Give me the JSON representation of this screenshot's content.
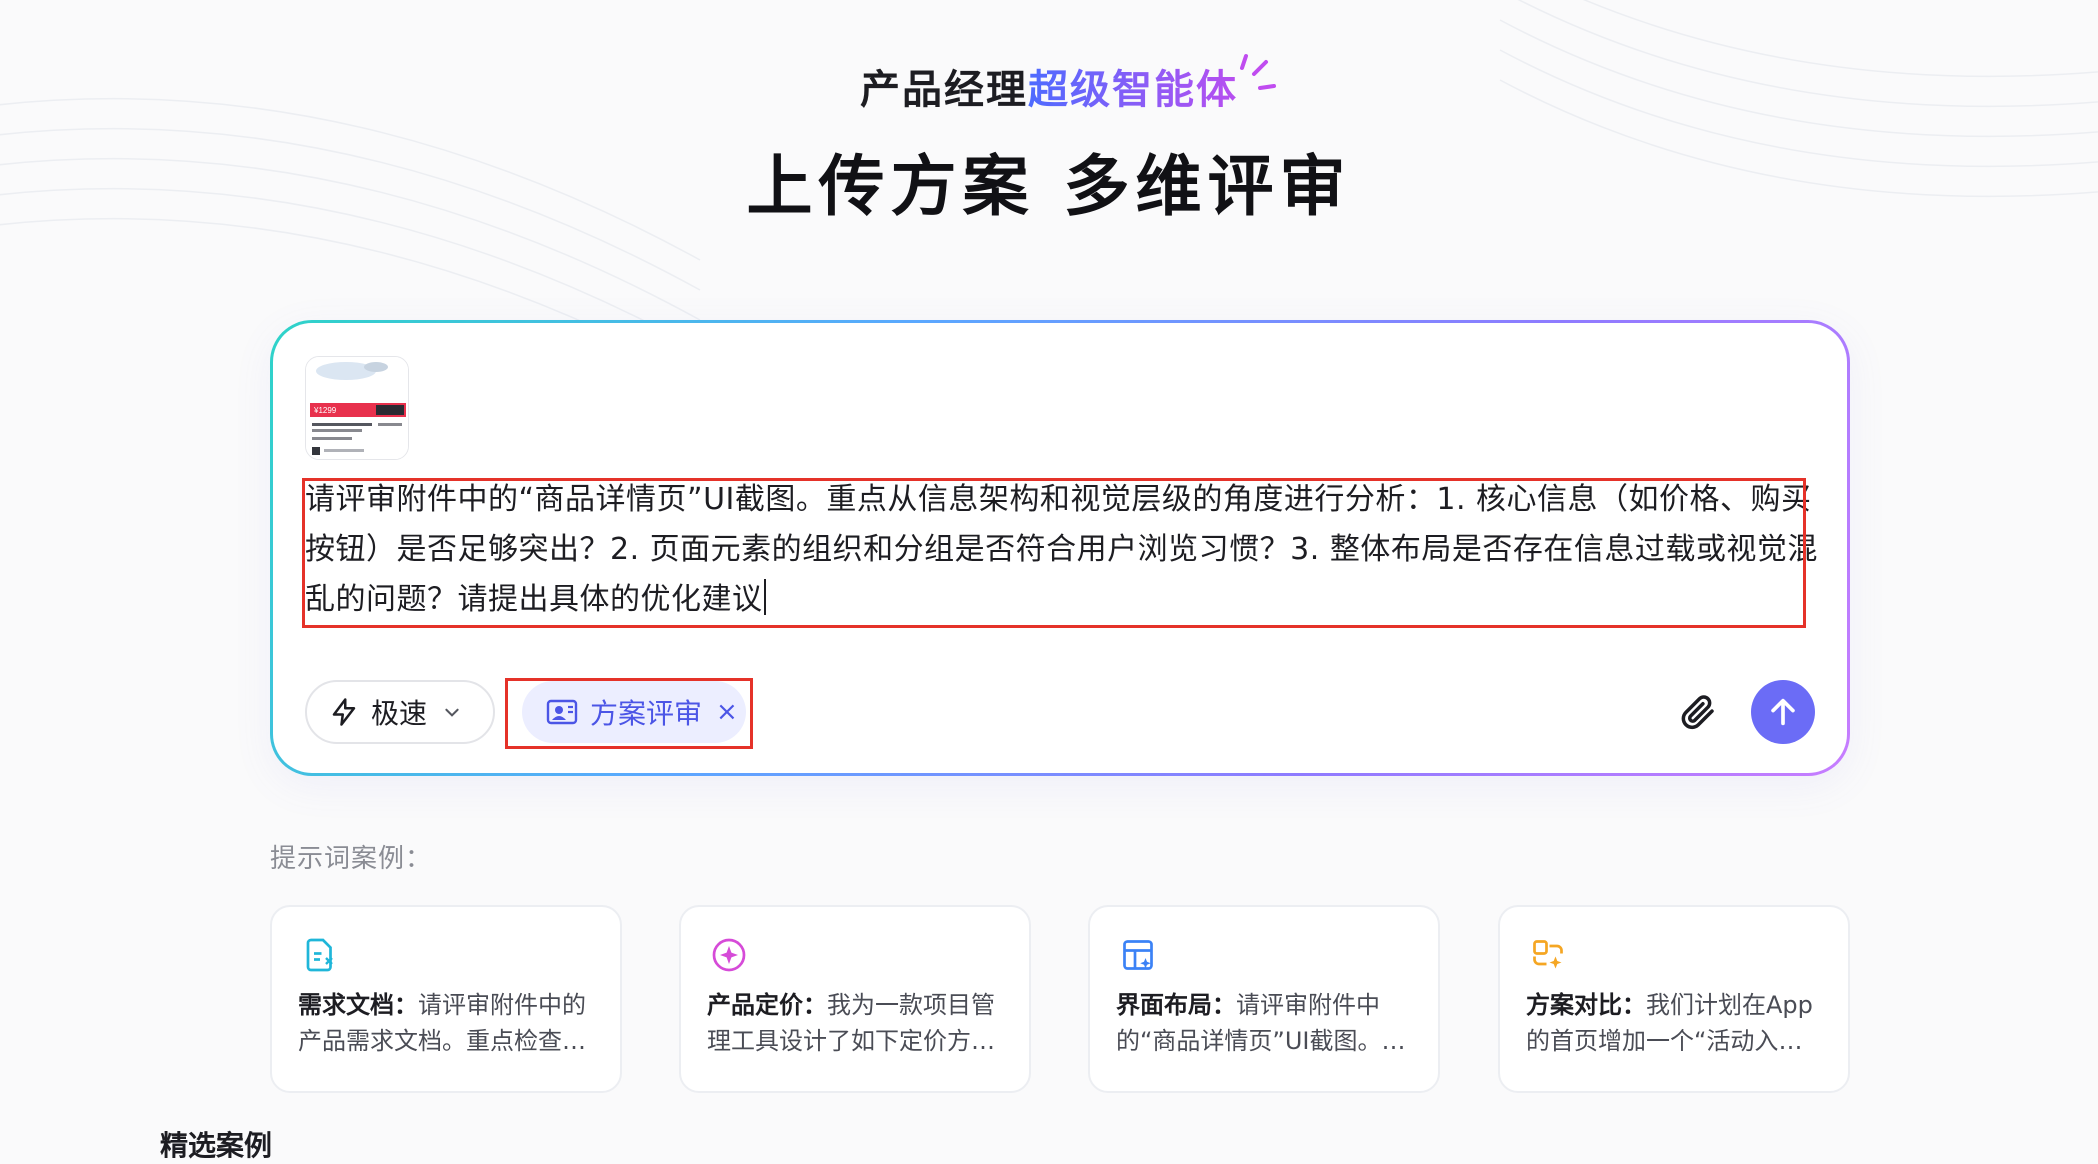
{
  "hero": {
    "subtitle_prefix": "产品经理",
    "subtitle_highlight": "超级智能体",
    "title": "上传方案 多维评审"
  },
  "composer": {
    "prompt_text": "请评审附件中的“商品详情页”UI截图。重点从信息架构和视觉层级的角度进行分析：1. 核心信息（如价格、购买按钮）是否足够突出？2. 页面元素的组织和分组是否符合用户浏览习惯？3. 整体布局是否存在信息过载或视觉混乱的问题？请提出具体的优化建议",
    "mode_label": "极速",
    "tag_label": "方案评审",
    "tag_close": "×",
    "attachment": {
      "thumb_price": "¥1299"
    },
    "colors": {
      "send": "#6b6cf6",
      "tag_bg": "#eceeff",
      "tag_text": "#4b55e6",
      "highlight": "#e53229"
    }
  },
  "examples": {
    "label": "提示词案例：",
    "cards": [
      {
        "icon": "document-icon",
        "title": "需求文档：",
        "body": "请评审附件中的产品需求文档。重点检查需求完整性与逻辑一致性",
        "color": "#1fb6d9"
      },
      {
        "icon": "sparkle-circle-icon",
        "title": "产品定价：",
        "body": "我为一款项目管理工具设计了如下定价方案，请评审",
        "color": "#d64bd8"
      },
      {
        "icon": "layout-icon",
        "title": "界面布局：",
        "body": "请评审附件中的“商品详情页”UI截图。重点分析布局",
        "color": "#3b82f6"
      },
      {
        "icon": "compare-icon",
        "title": "方案对比：",
        "body": "我们计划在App的首页增加一个“活动入口”，请对比两个方案",
        "color": "#f5a623"
      }
    ]
  },
  "featured": {
    "label": "精选案例"
  }
}
